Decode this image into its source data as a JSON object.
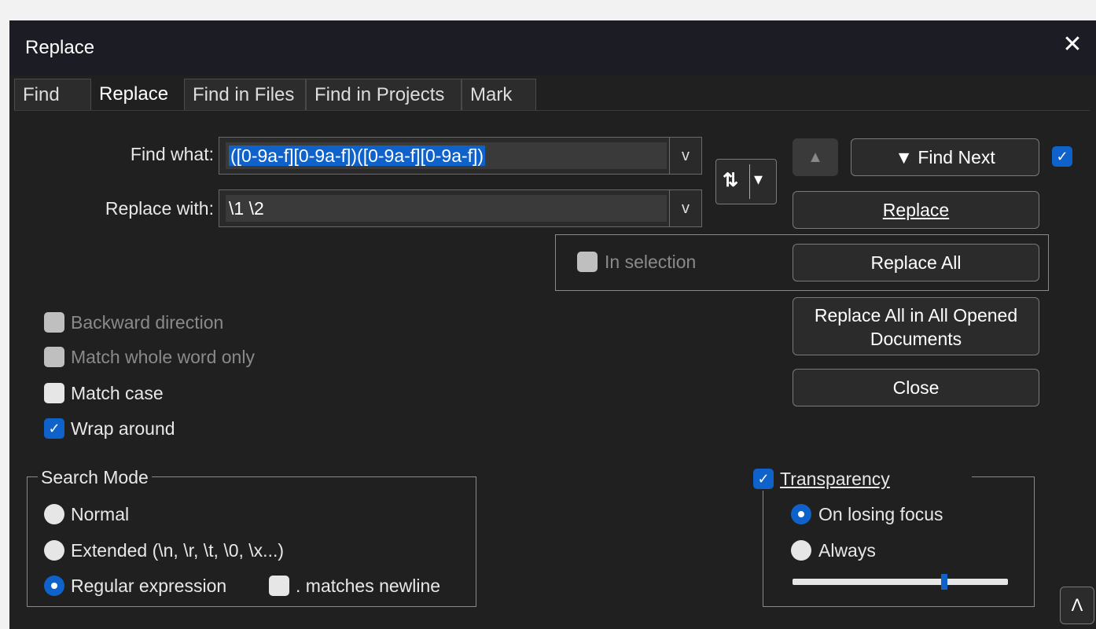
{
  "window": {
    "title": "Replace"
  },
  "tabs": [
    "Find",
    "Replace",
    "Find in Files",
    "Find in Projects",
    "Mark"
  ],
  "find": {
    "label": "Find what:",
    "value": "([0-9a-f][0-9a-f])([0-9a-f][0-9a-f])"
  },
  "replace": {
    "label": "Replace with:",
    "value": "\\1 \\2"
  },
  "dropdown_arrow": "v",
  "buttons": {
    "find_next": "▼ Find Next",
    "find_prev": "▲",
    "replace": "Replace",
    "replace_all": "Replace All",
    "replace_all_opened": "Replace All in All Opened Documents",
    "close": "Close",
    "swap": "⇅",
    "swap_arrow": "▾",
    "collapse": "Λ"
  },
  "in_selection": {
    "label": "In selection",
    "checked": false
  },
  "options": [
    {
      "label": "Backward direction",
      "checked": false,
      "enabled": false
    },
    {
      "label": "Match whole word only",
      "checked": false,
      "enabled": false
    },
    {
      "label": "Match case",
      "checked": false,
      "enabled": true
    },
    {
      "label": "Wrap around",
      "checked": true,
      "enabled": true
    }
  ],
  "search_mode": {
    "title": "Search Mode",
    "normal": "Normal",
    "extended": "Extended (\\n, \\r, \\t, \\0, \\x...)",
    "regex": "Regular expression",
    "dot_newline": ". matches newline",
    "selected": "regex"
  },
  "transparency": {
    "label": "Transparency",
    "checked": true,
    "on_losing_focus": "On losing focus",
    "always": "Always",
    "mode": "on_losing_focus",
    "slider_value": 0.71
  },
  "colors": {
    "accent": "#0f62c9",
    "bg": "#202020",
    "title_bg": "#1b1c24"
  }
}
